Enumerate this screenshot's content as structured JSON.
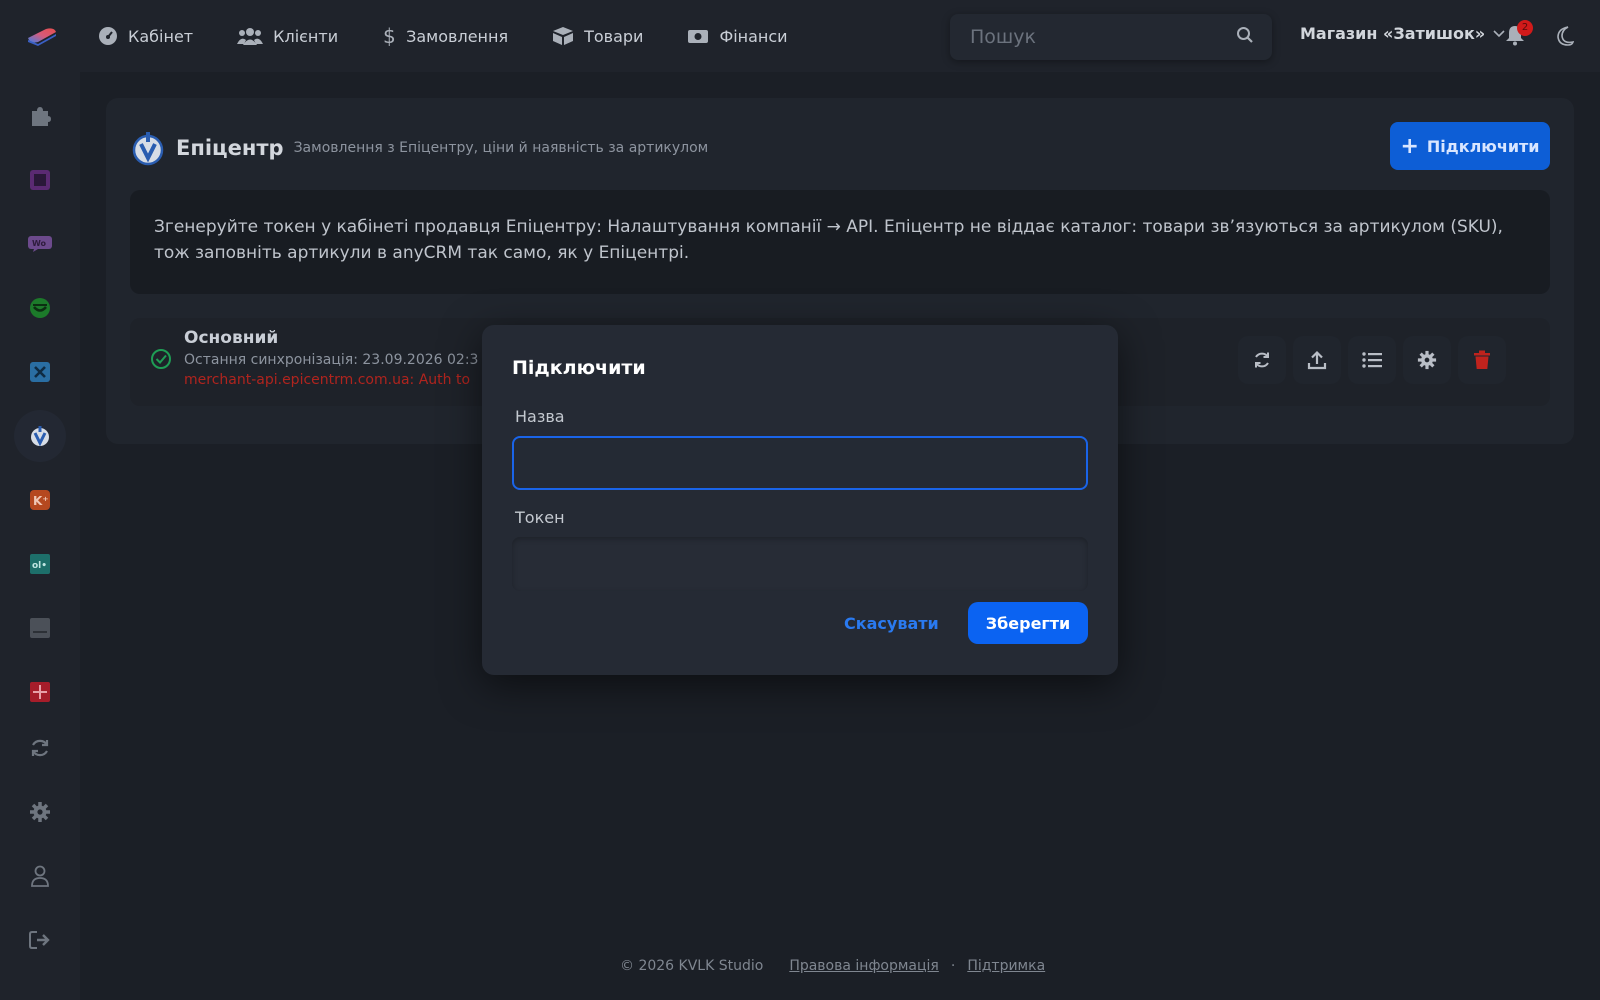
{
  "topbar": {
    "nav": [
      {
        "label": "Кабінет",
        "icon": "dashboard-icon"
      },
      {
        "label": "Клієнти",
        "icon": "users-icon"
      },
      {
        "label": "Замовлення",
        "icon": "dollar-icon"
      },
      {
        "label": "Товари",
        "icon": "box-icon"
      },
      {
        "label": "Фінанси",
        "icon": "money-icon"
      }
    ],
    "search_placeholder": "Пошук",
    "store_name": "Магазин «Затишок»",
    "notification_count": "2"
  },
  "sidebar": {
    "items": [
      {
        "name": "puzzle",
        "icon": "puzzle-icon"
      },
      {
        "name": "integration-1",
        "icon": "square-app-icon"
      },
      {
        "name": "woo",
        "icon": "woo-icon"
      },
      {
        "name": "integration-3",
        "icon": "green-smile-icon"
      },
      {
        "name": "integration-x",
        "icon": "x-app-icon"
      },
      {
        "name": "epicentr",
        "icon": "epicentr-icon",
        "active": true
      },
      {
        "name": "integration-k",
        "icon": "k-plus-icon"
      },
      {
        "name": "integration-olx",
        "icon": "olx-icon"
      },
      {
        "name": "integration-grey",
        "icon": "grey-app-icon"
      },
      {
        "name": "integration-red",
        "icon": "red-app-icon"
      },
      {
        "name": "sync",
        "icon": "sync-icon"
      },
      {
        "name": "settings",
        "icon": "gear-icon"
      },
      {
        "name": "profile",
        "icon": "user-icon"
      },
      {
        "name": "logout",
        "icon": "logout-icon"
      }
    ]
  },
  "main": {
    "title": "Епіцентр",
    "subtitle": "Замовлення з Епіцентру, ціни й наявність за артикулом",
    "connect_label": "Підключити",
    "info_text": "Згенеруйте токен у кабінеті продавця Епіцентру: Налаштування компанії → API. Епіцентр не віддає каталог: товари зв’язуються за артикулом (SKU), тож заповніть артикули в anyCRM так само, як у Епіцентрі.",
    "connection": {
      "name": "Основний",
      "sync_text": "Остання синхронізація: 23.09.2026 02:3",
      "error_text": "merchant-api.epicentrm.com.ua: Auth to"
    }
  },
  "modal": {
    "title": "Підключити",
    "name_label": "Назва",
    "name_value": "",
    "token_label": "Токен",
    "token_value": "",
    "cancel_label": "Скасувати",
    "save_label": "Зберегти"
  },
  "footer": {
    "copyright": "© 2026 KVLK Studio",
    "legal": "Правова інформація",
    "separator": "·",
    "support": "Підтримка"
  },
  "colors": {
    "accent": "#0b63f2",
    "danger": "#c0231d",
    "success": "#1f9d55"
  }
}
